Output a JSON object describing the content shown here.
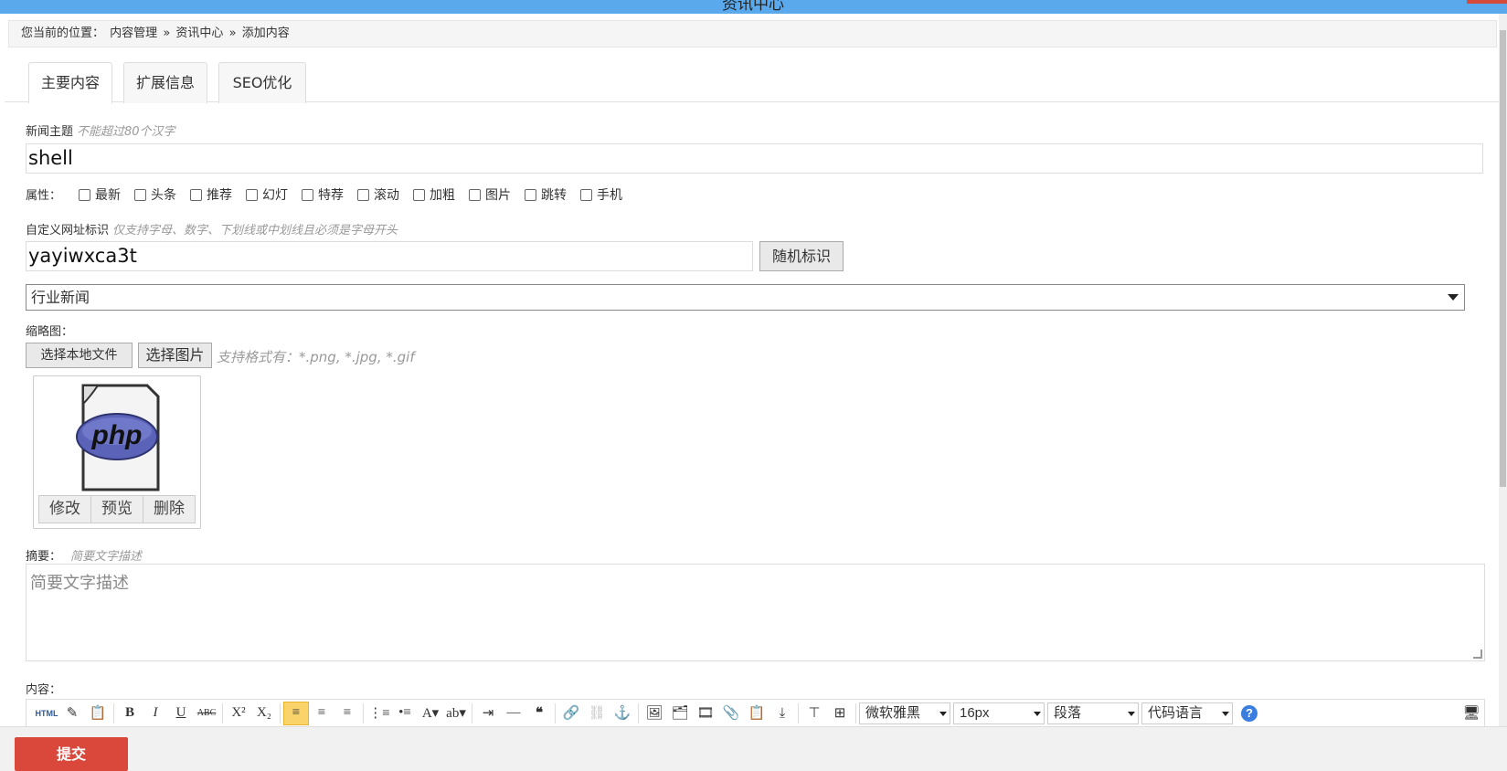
{
  "window": {
    "title": "资讯中心"
  },
  "breadcrumb": {
    "prefix": "您当前的位置：",
    "items": [
      "内容管理",
      "»",
      "资讯中心",
      "»",
      "添加内容"
    ]
  },
  "tabs": [
    "主要内容",
    "扩展信息",
    "SEO优化"
  ],
  "title_field": {
    "label": "新闻主题",
    "hint": "不能超过80个汉字",
    "value": "shell"
  },
  "attributes": {
    "label": "属性：",
    "options": [
      "最新",
      "头条",
      "推荐",
      "幻灯",
      "特荐",
      "滚动",
      "加粗",
      "图片",
      "跳转",
      "手机"
    ]
  },
  "url_field": {
    "label": "自定义网址标识",
    "hint": "仅支持字母、数字、下划线或中划线且必须是字母开头",
    "value": "yayiwxca3t",
    "random_button": "随机标识"
  },
  "category_select": {
    "value": "行业新闻"
  },
  "thumbnail": {
    "label": "缩略图：",
    "local_button": "选择本地文件",
    "image_button": "选择图片",
    "hint": "支持格式有：*.png, *.jpg, *.gif",
    "file_icon": "php-file-icon",
    "actions": [
      "修改",
      "预览",
      "删除"
    ]
  },
  "summary": {
    "label": "摘要：",
    "hint": "简要文字描述",
    "placeholder": "简要文字描述"
  },
  "content": {
    "label": "内容："
  },
  "editor_toolbar": {
    "html_label": "HTML",
    "font": "微软雅黑",
    "size": "16px",
    "paragraph": "段落",
    "code": "代码语言"
  },
  "submit_button": "提交",
  "colors": {
    "titlebar": "#5aa9ec",
    "submit": "#d9483b",
    "accent_selected": "#fbd36b"
  }
}
